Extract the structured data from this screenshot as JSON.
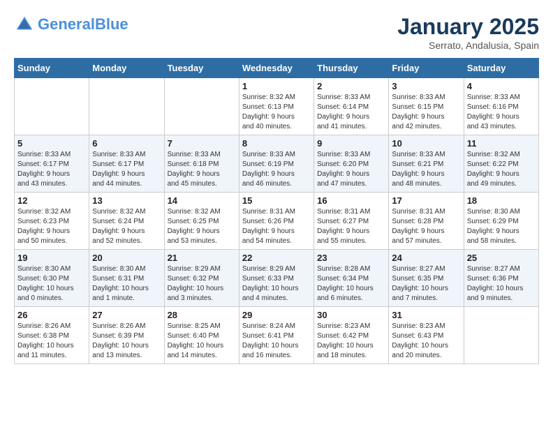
{
  "header": {
    "logo_line1": "General",
    "logo_line2": "Blue",
    "month_title": "January 2025",
    "location": "Serrato, Andalusia, Spain"
  },
  "days_of_week": [
    "Sunday",
    "Monday",
    "Tuesday",
    "Wednesday",
    "Thursday",
    "Friday",
    "Saturday"
  ],
  "weeks": [
    [
      {
        "num": "",
        "info": ""
      },
      {
        "num": "",
        "info": ""
      },
      {
        "num": "",
        "info": ""
      },
      {
        "num": "1",
        "info": "Sunrise: 8:32 AM\nSunset: 6:13 PM\nDaylight: 9 hours\nand 40 minutes."
      },
      {
        "num": "2",
        "info": "Sunrise: 8:33 AM\nSunset: 6:14 PM\nDaylight: 9 hours\nand 41 minutes."
      },
      {
        "num": "3",
        "info": "Sunrise: 8:33 AM\nSunset: 6:15 PM\nDaylight: 9 hours\nand 42 minutes."
      },
      {
        "num": "4",
        "info": "Sunrise: 8:33 AM\nSunset: 6:16 PM\nDaylight: 9 hours\nand 43 minutes."
      }
    ],
    [
      {
        "num": "5",
        "info": "Sunrise: 8:33 AM\nSunset: 6:17 PM\nDaylight: 9 hours\nand 43 minutes."
      },
      {
        "num": "6",
        "info": "Sunrise: 8:33 AM\nSunset: 6:17 PM\nDaylight: 9 hours\nand 44 minutes."
      },
      {
        "num": "7",
        "info": "Sunrise: 8:33 AM\nSunset: 6:18 PM\nDaylight: 9 hours\nand 45 minutes."
      },
      {
        "num": "8",
        "info": "Sunrise: 8:33 AM\nSunset: 6:19 PM\nDaylight: 9 hours\nand 46 minutes."
      },
      {
        "num": "9",
        "info": "Sunrise: 8:33 AM\nSunset: 6:20 PM\nDaylight: 9 hours\nand 47 minutes."
      },
      {
        "num": "10",
        "info": "Sunrise: 8:33 AM\nSunset: 6:21 PM\nDaylight: 9 hours\nand 48 minutes."
      },
      {
        "num": "11",
        "info": "Sunrise: 8:32 AM\nSunset: 6:22 PM\nDaylight: 9 hours\nand 49 minutes."
      }
    ],
    [
      {
        "num": "12",
        "info": "Sunrise: 8:32 AM\nSunset: 6:23 PM\nDaylight: 9 hours\nand 50 minutes."
      },
      {
        "num": "13",
        "info": "Sunrise: 8:32 AM\nSunset: 6:24 PM\nDaylight: 9 hours\nand 52 minutes."
      },
      {
        "num": "14",
        "info": "Sunrise: 8:32 AM\nSunset: 6:25 PM\nDaylight: 9 hours\nand 53 minutes."
      },
      {
        "num": "15",
        "info": "Sunrise: 8:31 AM\nSunset: 6:26 PM\nDaylight: 9 hours\nand 54 minutes."
      },
      {
        "num": "16",
        "info": "Sunrise: 8:31 AM\nSunset: 6:27 PM\nDaylight: 9 hours\nand 55 minutes."
      },
      {
        "num": "17",
        "info": "Sunrise: 8:31 AM\nSunset: 6:28 PM\nDaylight: 9 hours\nand 57 minutes."
      },
      {
        "num": "18",
        "info": "Sunrise: 8:30 AM\nSunset: 6:29 PM\nDaylight: 9 hours\nand 58 minutes."
      }
    ],
    [
      {
        "num": "19",
        "info": "Sunrise: 8:30 AM\nSunset: 6:30 PM\nDaylight: 10 hours\nand 0 minutes."
      },
      {
        "num": "20",
        "info": "Sunrise: 8:30 AM\nSunset: 6:31 PM\nDaylight: 10 hours\nand 1 minute."
      },
      {
        "num": "21",
        "info": "Sunrise: 8:29 AM\nSunset: 6:32 PM\nDaylight: 10 hours\nand 3 minutes."
      },
      {
        "num": "22",
        "info": "Sunrise: 8:29 AM\nSunset: 6:33 PM\nDaylight: 10 hours\nand 4 minutes."
      },
      {
        "num": "23",
        "info": "Sunrise: 8:28 AM\nSunset: 6:34 PM\nDaylight: 10 hours\nand 6 minutes."
      },
      {
        "num": "24",
        "info": "Sunrise: 8:27 AM\nSunset: 6:35 PM\nDaylight: 10 hours\nand 7 minutes."
      },
      {
        "num": "25",
        "info": "Sunrise: 8:27 AM\nSunset: 6:36 PM\nDaylight: 10 hours\nand 9 minutes."
      }
    ],
    [
      {
        "num": "26",
        "info": "Sunrise: 8:26 AM\nSunset: 6:38 PM\nDaylight: 10 hours\nand 11 minutes."
      },
      {
        "num": "27",
        "info": "Sunrise: 8:26 AM\nSunset: 6:39 PM\nDaylight: 10 hours\nand 13 minutes."
      },
      {
        "num": "28",
        "info": "Sunrise: 8:25 AM\nSunset: 6:40 PM\nDaylight: 10 hours\nand 14 minutes."
      },
      {
        "num": "29",
        "info": "Sunrise: 8:24 AM\nSunset: 6:41 PM\nDaylight: 10 hours\nand 16 minutes."
      },
      {
        "num": "30",
        "info": "Sunrise: 8:23 AM\nSunset: 6:42 PM\nDaylight: 10 hours\nand 18 minutes."
      },
      {
        "num": "31",
        "info": "Sunrise: 8:23 AM\nSunset: 6:43 PM\nDaylight: 10 hours\nand 20 minutes."
      },
      {
        "num": "",
        "info": ""
      }
    ]
  ]
}
